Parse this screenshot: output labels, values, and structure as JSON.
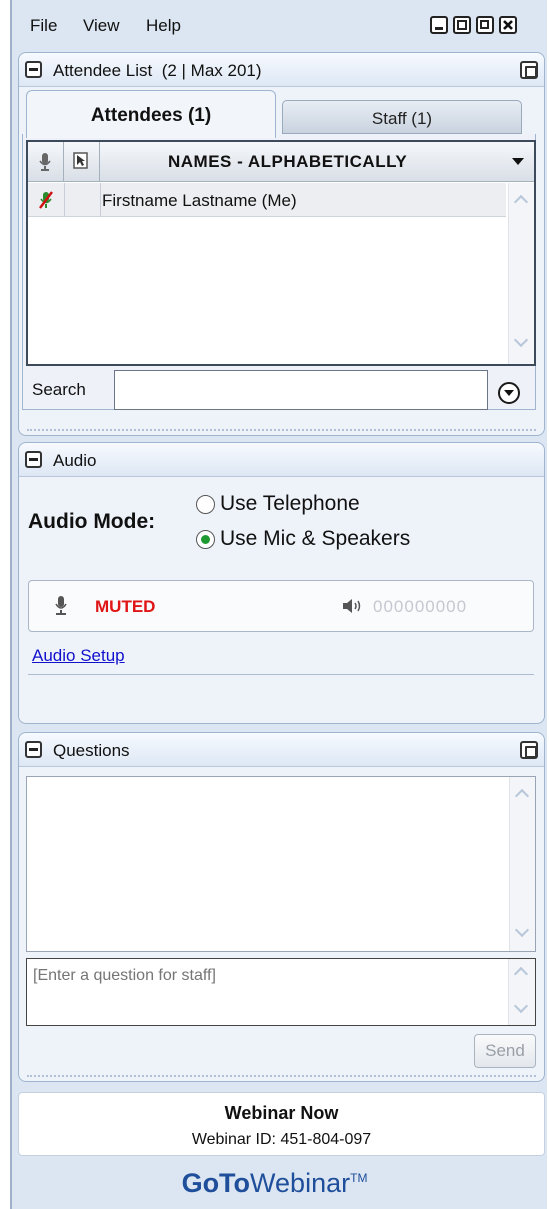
{
  "menu": {
    "file": "File",
    "view": "View",
    "help": "Help"
  },
  "attendee_panel": {
    "title": "Attendee List",
    "count": "(2 | Max 201)",
    "tabs": {
      "attendees": "Attendees (1)",
      "staff": "Staff (1)"
    },
    "column_header": "NAMES - ALPHABETICALLY",
    "rows": [
      {
        "name": "Firstname Lastname (Me)"
      }
    ],
    "search_label": "Search",
    "search_value": ""
  },
  "audio_panel": {
    "title": "Audio",
    "mode_label": "Audio Mode:",
    "options": [
      "Use Telephone",
      "Use Mic & Speakers"
    ],
    "selected_option": "Use Mic & Speakers",
    "mic_status": "MUTED",
    "level_display": "000000000",
    "setup_link": "Audio Setup"
  },
  "questions_panel": {
    "title": "Questions",
    "input_placeholder": "[Enter a question for staff]",
    "send_label": "Send"
  },
  "footer": {
    "title": "Webinar Now",
    "webinar_id": "Webinar ID: 451-804-097",
    "brand_bold": "GoTo",
    "brand_light": "Webinar",
    "brand_tm": "TM"
  },
  "colors": {
    "accent_blue": "#1f4e9a",
    "muted_red": "#e01515",
    "radio_green": "#1f9a32",
    "link_blue": "#1111cc"
  }
}
